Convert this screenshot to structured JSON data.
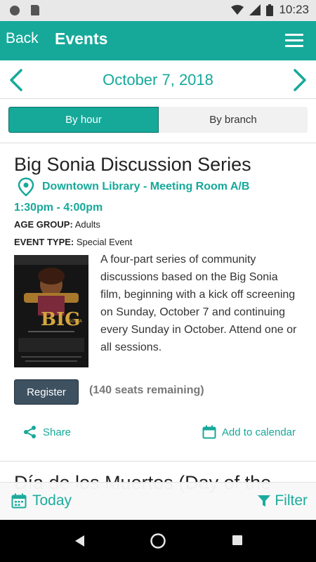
{
  "status_bar": {
    "time": "10:23"
  },
  "app_bar": {
    "back_label": "Back",
    "title": "Events"
  },
  "date_nav": {
    "date": "October 7, 2018"
  },
  "view_toggle": {
    "by_hour": "By hour",
    "by_branch": "By branch",
    "selected": "By hour"
  },
  "event": {
    "title": "Big Sonia Discussion Series",
    "location": "Downtown Library - Meeting Room A/B",
    "time": "1:30pm - 4:00pm",
    "age_group_label": "AGE GROUP:",
    "age_group": "Adults",
    "event_type_label": "EVENT TYPE:",
    "event_type": "Special Event",
    "poster_text": "BIG",
    "poster_subtext": "SONIA",
    "description": "A four-part series of community discussions based on the Big Sonia film, beginning with a kick off screening on Sunday, October 7 and continuing every Sunday in October. Attend one or all sessions.",
    "register_label": "Register",
    "seats_remaining": "(140 seats remaining)",
    "share_label": "Share",
    "add_calendar_label": "Add to calendar"
  },
  "next_event": {
    "title_partial": "Día de los Muertos (Day of the"
  },
  "bottom_bar": {
    "today_label": "Today",
    "filter_label": "Filter"
  },
  "colors": {
    "accent": "#16a99a",
    "register_button": "#3d5161",
    "status_bar": "#e8e8e8"
  },
  "icons": [
    "chevron-left-icon",
    "chevron-right-icon",
    "menu-icon",
    "location-pin-icon",
    "share-icon",
    "calendar-icon",
    "filter-icon",
    "back-triangle-icon",
    "home-circle-icon",
    "recents-square-icon"
  ]
}
